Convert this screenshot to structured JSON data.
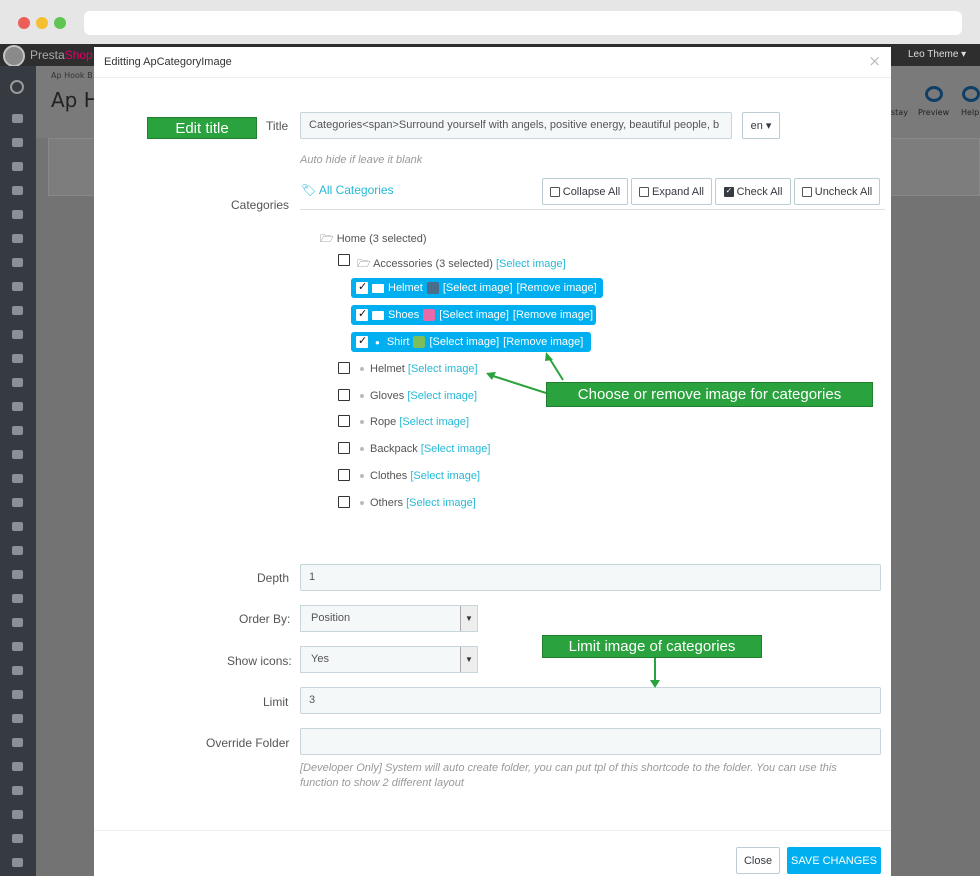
{
  "backdrop": {
    "brand_text": "Presta",
    "brand_accent": "Shop",
    "breadcrumb": "Ap Hook B",
    "page_title": "Ap H",
    "user_menu": "Leo Theme",
    "stay_label": "stay",
    "preview_label": "Preview",
    "help_label": "Help"
  },
  "modal": {
    "title": "Editting ApCategoryImage",
    "close_glyph": "×",
    "title_label": "Title",
    "title_value": "Categories<span>Surround yourself with angels, positive energy, beautiful people, b",
    "language": "en",
    "title_help": "Auto hide if leave it blank",
    "categories_label": "Categories",
    "all_categories": "All Categories",
    "tree_buttons": {
      "collapse": "Collapse All",
      "expand": "Expand All",
      "check": "Check All",
      "uncheck": "Uncheck All"
    },
    "tree": {
      "home": "Home (3 selected)",
      "accessories": "Accessories (3 selected)",
      "select_image": "[Select image]",
      "remove_image": "[Remove image]",
      "selected_items": [
        "Helmet",
        "Shoes",
        "Shirt"
      ],
      "items": [
        "Helmet",
        "Gloves",
        "Rope",
        "Backpack",
        "Clothes",
        "Others"
      ]
    },
    "depth_label": "Depth",
    "depth_value": "1",
    "order_label": "Order By:",
    "order_value": "Position",
    "icons_label": "Show icons:",
    "icons_value": "Yes",
    "limit_label": "Limit",
    "limit_value": "3",
    "override_label": "Override Folder",
    "override_value": "",
    "override_help_1": "[Developer Only] System will auto create folder, you can put tpl of this shortcode to the folder. You can use this",
    "override_help_2": "function to show 2 different layout",
    "close_button": "Close",
    "save_button": "SAVE CHANGES"
  },
  "callouts": {
    "edit_title": "Edit title",
    "choose_image": "Choose or remove image for categories",
    "limit_image": "Limit image of categories"
  },
  "colors": {
    "accent": "#25b9d7",
    "selected_row": "#00aff0",
    "callout_green": "#2aa23d",
    "save_button": "#00aff0"
  }
}
